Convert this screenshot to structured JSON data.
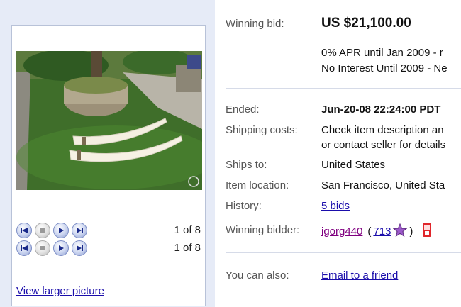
{
  "gallery": {
    "counter_1": "1 of 8",
    "counter_2": "1 of 8",
    "view_larger": "View larger picture"
  },
  "bid": {
    "label": "Winning bid:",
    "amount": "US $21,100.00",
    "financing_1": "0% APR until Jan 2009 - r",
    "financing_2": "No Interest Until 2009 - Ne"
  },
  "details": {
    "ended_label": "Ended:",
    "ended_value": "Jun-20-08 22:24:00 PDT",
    "shipping_label": "Shipping costs:",
    "shipping_value_1": "Check item description an",
    "shipping_value_2": "or contact seller for details",
    "ships_to_label": "Ships to:",
    "ships_to_value": "United States",
    "location_label": "Item location:",
    "location_value": "San Francisco, United Sta",
    "history_label": "History:",
    "history_value": "5 bids",
    "bidder_label": "Winning bidder:",
    "bidder_name": "igorg440",
    "bidder_open_paren": "(",
    "bidder_feedback": "713",
    "bidder_close_paren": ")"
  },
  "actions": {
    "also_label": "You can also:",
    "email_friend": "Email to a friend"
  },
  "icons": {
    "nav": [
      "first-icon",
      "stop-icon",
      "play-icon",
      "next-icon"
    ],
    "feedback_star": "purple-star-icon",
    "mobile": "red-phone-icon"
  },
  "colors": {
    "link": "#1a0dab",
    "star": "#9b59c9",
    "phone": "#e0262b"
  }
}
